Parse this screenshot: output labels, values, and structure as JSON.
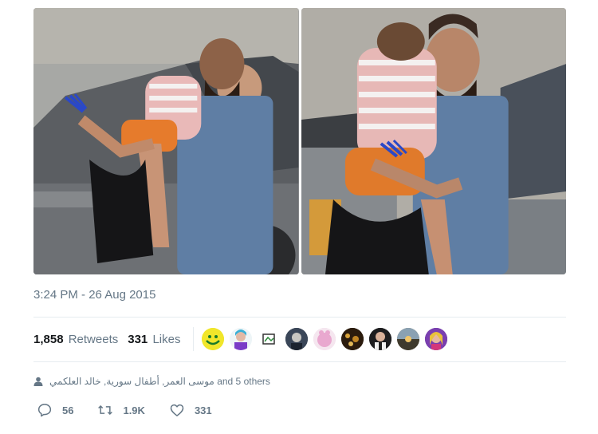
{
  "tweet": {
    "timestamp": "3:24 PM - 26 Aug 2015",
    "stats": {
      "retweets_count": "1,858",
      "retweets_label": "Retweets",
      "likes_count": "331",
      "likes_label": "Likes"
    },
    "liked_by_avatars": [
      "yellow-smiley",
      "cyan-portrait",
      "sticker-logo",
      "dark-portrait",
      "pink-cartoon",
      "night-scene",
      "suit-portrait",
      "sunset-landscape",
      "colorful-portrait"
    ],
    "mention_context": {
      "names": "موسى العمر, أطفال سورية, خالد العلكمي",
      "suffix": "and 5 others"
    },
    "actions": {
      "reply_count": "56",
      "retweet_count": "1.9K",
      "like_count": "331"
    }
  },
  "colors": {
    "muted_text": "#657786",
    "primary_text": "#14171a",
    "divider": "#e6ecf0"
  }
}
